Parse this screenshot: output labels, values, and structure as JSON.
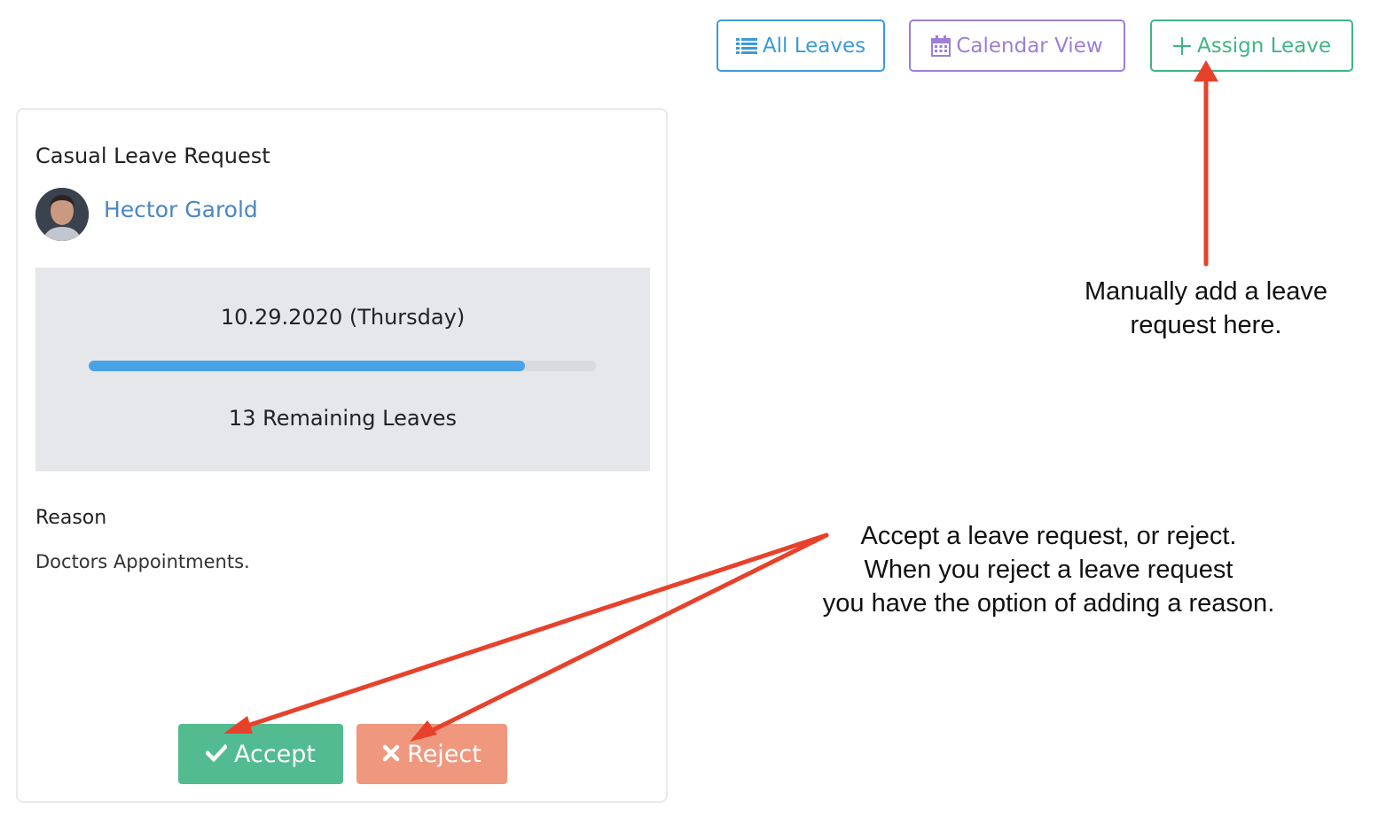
{
  "toolbar": {
    "all_leaves_label": "All Leaves",
    "calendar_view_label": "Calendar View",
    "assign_leave_label": "Assign Leave",
    "all_leaves_icon": "list-icon",
    "calendar_view_icon": "calendar-icon",
    "assign_leave_icon": "plus-icon"
  },
  "card": {
    "title": "Casual Leave Request",
    "employee_name": "Hector Garold",
    "date": "10.29.2020 (Thursday)",
    "progress_fraction": 0.86,
    "remaining": "13 Remaining Leaves",
    "reason_label": "Reason",
    "reason_text": "Doctors Appointments.",
    "accept_label": "Accept",
    "reject_label": "Reject",
    "accept_icon": "check-icon",
    "reject_icon": "x-icon"
  },
  "annotations": {
    "assign_note_line1": "Manually add a leave",
    "assign_note_line2": "request here.",
    "accept_note_line1": "Accept a leave request, or reject.",
    "accept_note_line2": "When you reject a leave request",
    "accept_note_line3": "you have the option of adding a reason."
  },
  "colors": {
    "blue": "#3d9ad8",
    "purple": "#9c7fd6",
    "green": "#3fb585",
    "accept_bg": "#52bb8f",
    "reject_bg": "#ef987d",
    "progress": "#4aa2e6",
    "arrow": "#e8412b"
  }
}
